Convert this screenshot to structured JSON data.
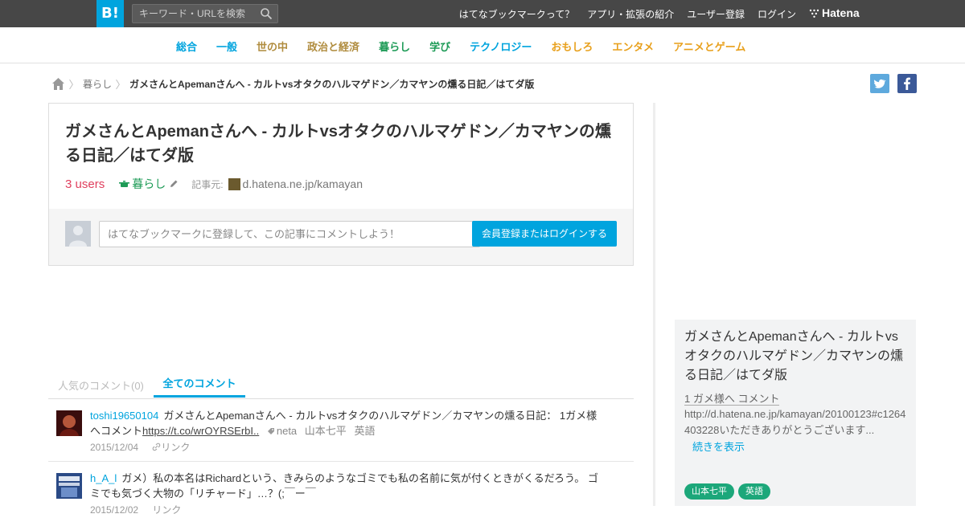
{
  "header": {
    "logo_text": "B!",
    "search_placeholder": "キーワード・URLを検索",
    "links": [
      "はてなブックマークって？",
      "アプリ・拡張の紹介",
      "ユーザー登録",
      "ログイン"
    ],
    "brand": "Hatena"
  },
  "categories": [
    {
      "label": "総合",
      "color": "#00a4de"
    },
    {
      "label": "一般",
      "color": "#00a4de"
    },
    {
      "label": "世の中",
      "color": "#b08c3e"
    },
    {
      "label": "政治と経済",
      "color": "#b08c3e"
    },
    {
      "label": "暮らし",
      "color": "#1e9b57"
    },
    {
      "label": "学び",
      "color": "#1e9b57"
    },
    {
      "label": "テクノロジー",
      "color": "#00a4de"
    },
    {
      "label": "おもしろ",
      "color": "#e8a01c"
    },
    {
      "label": "エンタメ",
      "color": "#e8a01c"
    },
    {
      "label": "アニメとゲーム",
      "color": "#e8a01c"
    }
  ],
  "breadcrumb": {
    "category": "暮らし",
    "title": "ガメさんとApemanさんへ - カルトvsオタクのハルマゲドン／カマヤンの燻る日記／はてダ版"
  },
  "entry": {
    "title": "ガメさんとApemanさんへ - カルトvsオタクのハルマゲドン／カマヤンの燻る日記／はてダ版",
    "users": "3 users",
    "category": "暮らし",
    "source_label": "記事元:",
    "source": "d.hatena.ne.jp/kamayan",
    "comment_placeholder": "はてなブックマークに登録して、この記事にコメントしよう！",
    "login_button": "会員登録またはログインする"
  },
  "tabs": {
    "popular": "人気のコメント(0)",
    "all": "全てのコメント"
  },
  "comments": [
    {
      "user": "toshi19650104",
      "text": "ガメさんとApemanさんへ - カルトvsオタクのハルマゲドン／カマヤンの燻る日記： 1ガメ様へコメント",
      "link": "https://t.co/wrOYRSErbI..",
      "tags": [
        "neta",
        "山本七平",
        "英語"
      ],
      "date": "2015/12/04",
      "link_label": "リンク"
    },
    {
      "user": "h_A_l",
      "text": "ガメ）私の本名はRichardという、きみらのようなゴミでも私の名前に気が付くときがくるだろう。 ゴミでも気づく大物の「リチャード」…？(;￣ー￣",
      "date": "2015/12/02",
      "link_label": "リンク"
    }
  ],
  "sidebar": {
    "title": "ガメさんとApemanさんへ - カルトvsオタクのハルマゲドン／カマヤンの燻る日記／はてダ版",
    "subtitle": "1 ガメ様へ コメント",
    "excerpt": "http://d.hatena.ne.jp/kamayan/20100123#c1264403228いただきありがとうございます...",
    "more": "続きを表示",
    "tags": [
      "山本七平",
      "英語"
    ]
  }
}
